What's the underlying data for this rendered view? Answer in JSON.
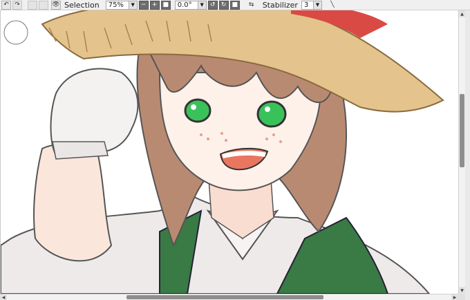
{
  "toolbar": {
    "selection_label": "Selection",
    "zoom_value": "75%",
    "rotation_value": "0.0°",
    "stabilizer_label": "Stabilizer",
    "stabilizer_value": "3"
  },
  "colors": {
    "accent_dark_button": "#6d6d6d",
    "overall_green": "#3a7a45",
    "hat_straw": "#e4c48c",
    "hat_band_red": "#d94a45",
    "hair_brown": "#b98a72",
    "eye_green": "#39c25a"
  },
  "icons": [
    "undo-icon",
    "redo-icon",
    "eye-icon",
    "dropdown-icon",
    "zoom-out-icon",
    "zoom-in-icon",
    "fit-icon",
    "rotate-ccw-icon",
    "rotate-cw-icon",
    "reset-rotation-icon",
    "flip-icon",
    "pen-line-icon"
  ]
}
